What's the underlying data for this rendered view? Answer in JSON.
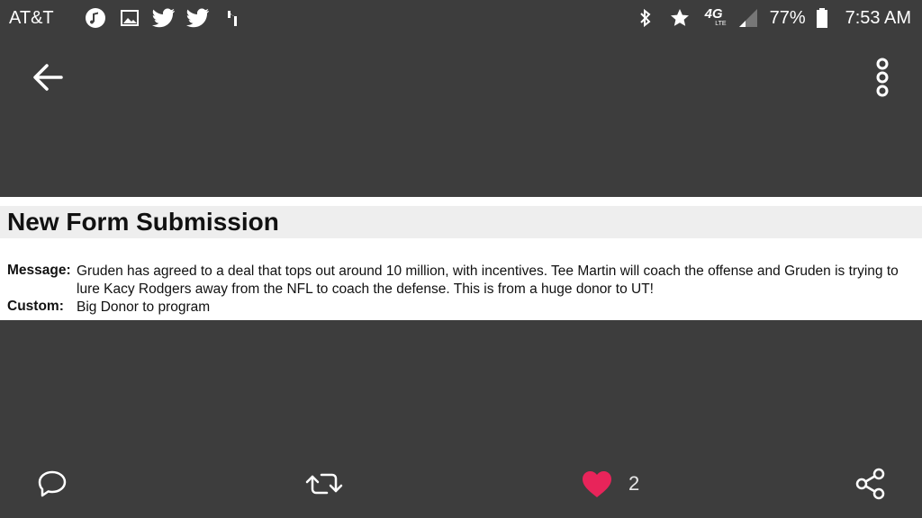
{
  "status_bar": {
    "carrier": "AT&T",
    "left_icons": [
      "music-note-icon",
      "image-icon",
      "twitter-icon",
      "twitter-icon",
      "antenna-icon"
    ],
    "right_icons": [
      "bluetooth-icon",
      "star-icon",
      "4g-lte-icon",
      "signal-icon"
    ],
    "network_label": "4G",
    "network_sub": "LTE",
    "battery": "77%",
    "time": "7:53 AM"
  },
  "toolbar": {
    "back_icon": "back-arrow-icon",
    "more_icon": "more-vert-icon"
  },
  "document": {
    "title": "New Form Submission",
    "fields": [
      {
        "label": "Message:",
        "value": "Gruden has agreed to a deal that tops out around 10 million, with incentives. Tee Martin will coach the offense and Gruden is trying to lure Kacy Rodgers away from the NFL to coach the defense. This is from a huge donor to UT!"
      },
      {
        "label": "Custom:",
        "value": "Big Donor to program"
      }
    ]
  },
  "actions": {
    "reply_icon": "reply-icon",
    "retweet_icon": "retweet-icon",
    "like_icon": "heart-icon",
    "like_count": "2",
    "share_icon": "share-icon",
    "like_color": "#e8245a"
  }
}
